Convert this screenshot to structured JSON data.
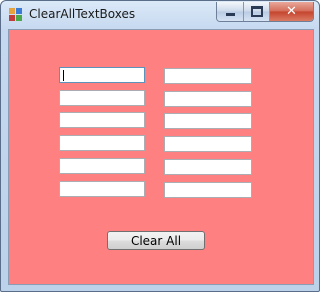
{
  "window": {
    "title": "ClearAllTextBoxes",
    "app_icon": "windows-forms-app-icon",
    "controls": {
      "minimize_icon": "minimize-icon",
      "maximize_icon": "maximize-icon",
      "close_icon": "close-icon",
      "close_glyph": "✕"
    }
  },
  "form": {
    "background_color": "#ff8080",
    "left_column": [
      {
        "value": "",
        "focused": true
      },
      {
        "value": ""
      },
      {
        "value": ""
      },
      {
        "value": ""
      },
      {
        "value": ""
      },
      {
        "value": ""
      }
    ],
    "right_column": [
      {
        "value": ""
      },
      {
        "value": ""
      },
      {
        "value": ""
      },
      {
        "value": ""
      },
      {
        "value": ""
      },
      {
        "value": ""
      }
    ],
    "clear_button_label": "Clear All"
  }
}
